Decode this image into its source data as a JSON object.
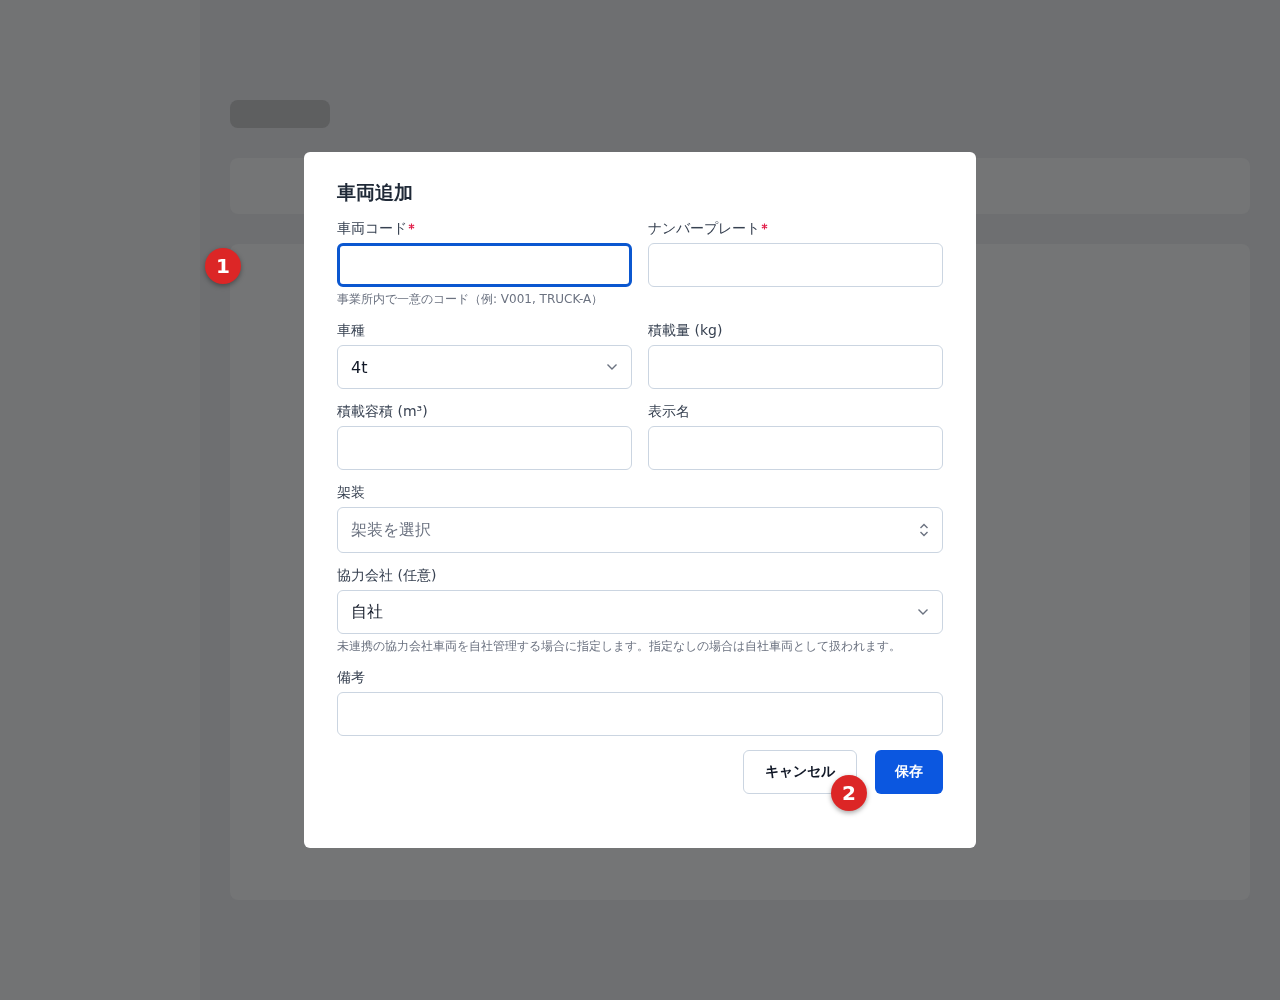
{
  "dialog": {
    "title": "車両追加",
    "rows": [
      {
        "fields": [
          {
            "kind": "text",
            "label": "車両コード",
            "required": true,
            "focused": true,
            "hint": "事業所内で一意のコード（例: V001, TRUCK-A）"
          },
          {
            "kind": "text",
            "label": "ナンバープレート",
            "required": true,
            "focused": false
          }
        ]
      },
      {
        "fields": [
          {
            "kind": "select",
            "label": "車種",
            "required": false,
            "focused": false,
            "value": "4t"
          },
          {
            "kind": "text",
            "label": "積載量 (kg)",
            "required": false,
            "focused": false
          }
        ]
      },
      {
        "fields": [
          {
            "kind": "text",
            "label": "積載容積 (m³)",
            "required": false,
            "focused": false
          },
          {
            "kind": "text",
            "label": "表示名",
            "required": false,
            "focused": false
          }
        ]
      },
      {
        "fields": [
          {
            "kind": "combobox",
            "label": "架装",
            "required": false,
            "focused": false,
            "placeholder": "架装を選択"
          }
        ]
      },
      {
        "fields": [
          {
            "kind": "select",
            "label": "協力会社 (任意)",
            "required": false,
            "focused": false,
            "value": "自社",
            "hint": "未連携の協力会社車両を自社管理する場合に指定します。指定なしの場合は自社車両として扱われます。"
          }
        ]
      },
      {
        "fields": [
          {
            "kind": "text",
            "label": "備考",
            "required": false,
            "focused": false
          }
        ]
      }
    ],
    "buttons": [
      {
        "kind": "secondary",
        "label": "キャンセル"
      },
      {
        "kind": "primary",
        "label": "保存"
      }
    ]
  },
  "markers": [
    {
      "label": "1"
    },
    {
      "label": "2"
    }
  ]
}
